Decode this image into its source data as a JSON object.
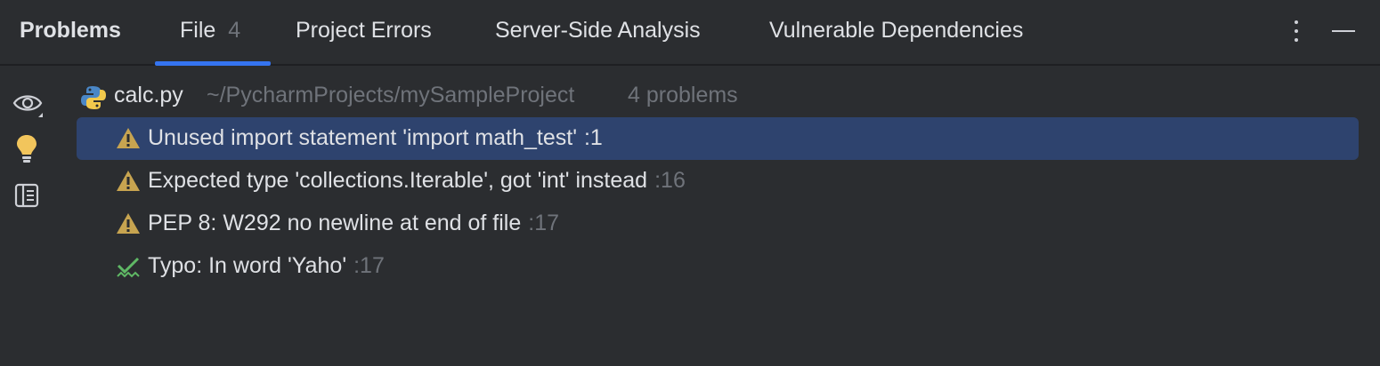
{
  "toolwindow": {
    "title": "Problems",
    "tabs": [
      {
        "label": "File",
        "count": "4"
      },
      {
        "label": "Project Errors"
      },
      {
        "label": "Server-Side Analysis"
      },
      {
        "label": "Vulnerable Dependencies"
      }
    ]
  },
  "sidebar": {
    "icons": [
      "eye-icon",
      "lightbulb-icon",
      "preview-panel-icon"
    ]
  },
  "file": {
    "name": "calc.py",
    "path": "~/PycharmProjects/mySampleProject",
    "problem_count": "4 problems"
  },
  "problems": [
    {
      "text": "Unused import statement 'import math_test'",
      "line": ":1",
      "severity": "warning",
      "selected": true
    },
    {
      "text": "Expected type 'collections.Iterable', got 'int' instead",
      "line": ":16",
      "severity": "warning",
      "selected": false
    },
    {
      "text": "PEP 8: W292 no newline at end of file",
      "line": ":17",
      "severity": "warning",
      "selected": false
    },
    {
      "text": "Typo: In word 'Yaho'",
      "line": ":17",
      "severity": "typo",
      "selected": false
    }
  ],
  "colors": {
    "background": "#2b2d30",
    "accent": "#3574f0",
    "selection": "#2e436e",
    "warning": "#c7a450",
    "typo": "#5fb865"
  }
}
